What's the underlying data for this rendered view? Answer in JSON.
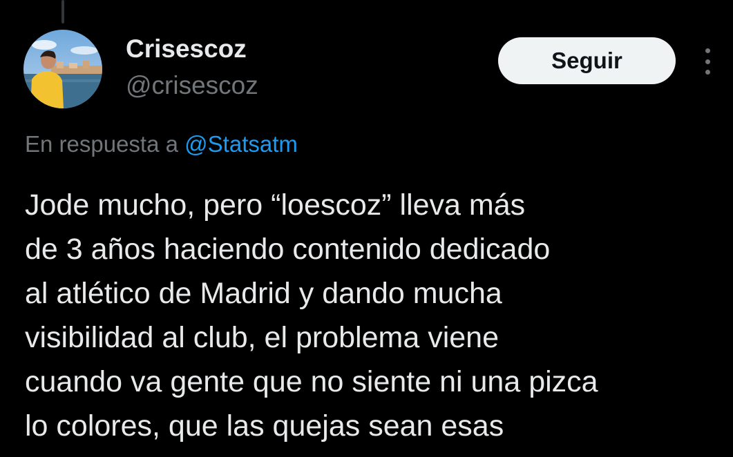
{
  "author": {
    "display_name": "Crisescoz",
    "handle": "@crisescoz",
    "avatar_icon": "profile-photo"
  },
  "follow_button": {
    "label": "Seguir"
  },
  "more_icon": "more-vertical-icon",
  "reply": {
    "prefix": "En respuesta a ",
    "mention": "@Statsatm"
  },
  "tweet": {
    "lines": [
      "Jode mucho, pero “loescoz” lleva más",
      "de 3 años haciendo contenido dedicado",
      "al atlético de Madrid y dando mucha",
      "visibilidad al club, el problema viene",
      "cuando va gente que no siente ni una pizca",
      "lo colores, que las quejas sean esas"
    ]
  },
  "colors": {
    "background": "#000000",
    "primary_text": "#e7e9ea",
    "secondary_text": "#71767b",
    "link": "#1d9bf0",
    "button_bg": "#eff3f4",
    "button_text": "#0f1419"
  }
}
